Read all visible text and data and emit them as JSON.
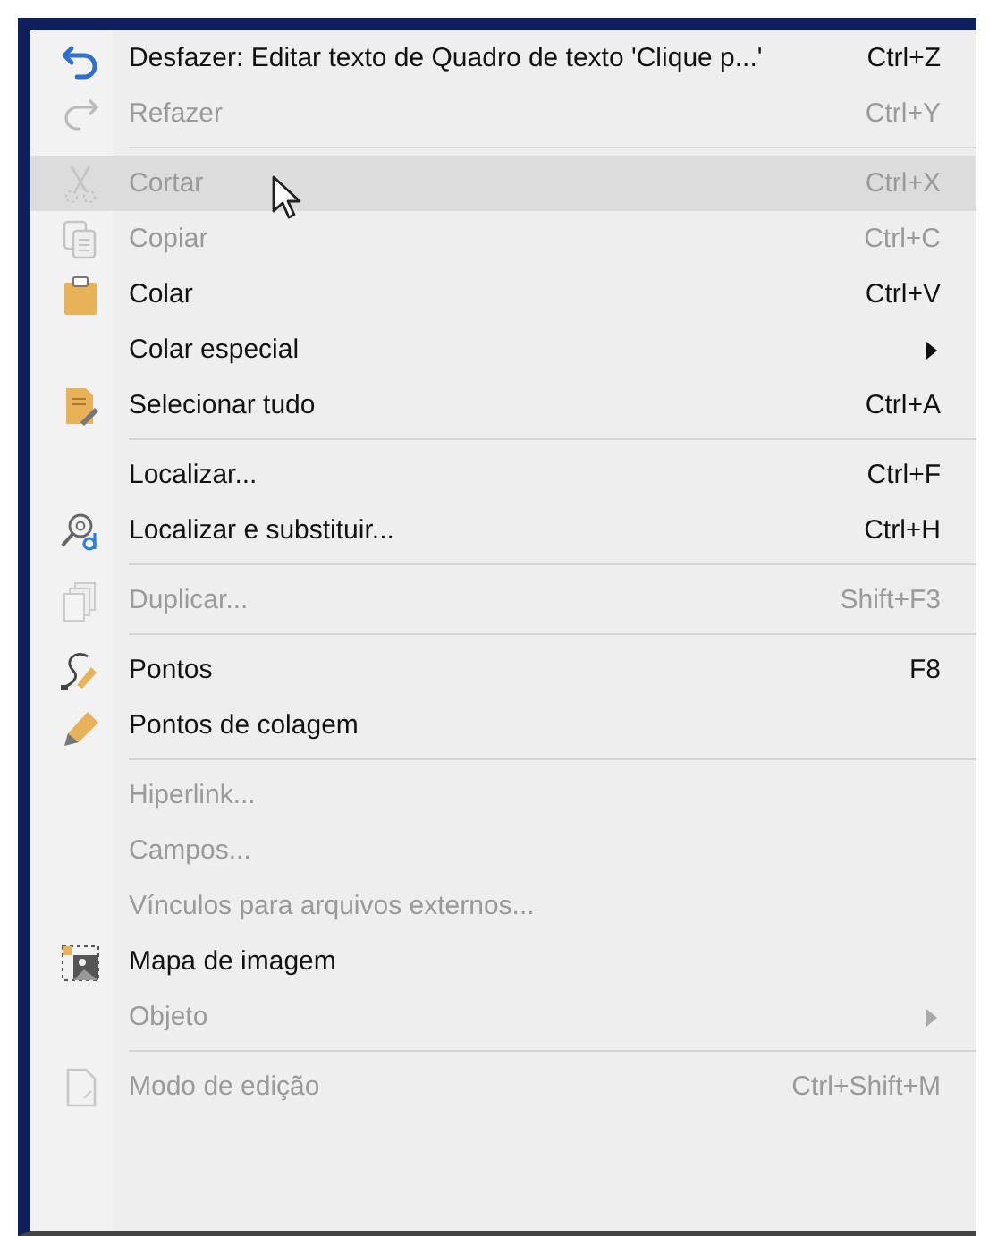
{
  "menu": {
    "items": [
      {
        "kind": "item",
        "label": "Desfazer: Editar texto de Quadro de texto 'Clique p...'",
        "shortcut": "Ctrl+Z",
        "disabled": false,
        "highlighted": false
      },
      {
        "kind": "item",
        "label": "Refazer",
        "shortcut": "Ctrl+Y",
        "disabled": true,
        "highlighted": false
      },
      {
        "kind": "separator"
      },
      {
        "kind": "item",
        "label": "Cortar",
        "shortcut": "Ctrl+X",
        "disabled": true,
        "highlighted": true
      },
      {
        "kind": "item",
        "label": "Copiar",
        "shortcut": "Ctrl+C",
        "disabled": true,
        "highlighted": false
      },
      {
        "kind": "item",
        "label": "Colar",
        "shortcut": "Ctrl+V",
        "disabled": false,
        "highlighted": false
      },
      {
        "kind": "submenu",
        "label": "Colar especial",
        "disabled": false,
        "highlighted": false
      },
      {
        "kind": "item",
        "label": "Selecionar tudo",
        "shortcut": "Ctrl+A",
        "disabled": false,
        "highlighted": false
      },
      {
        "kind": "separator"
      },
      {
        "kind": "item",
        "label": "Localizar...",
        "shortcut": "Ctrl+F",
        "disabled": false,
        "highlighted": false
      },
      {
        "kind": "item",
        "label": "Localizar e substituir...",
        "shortcut": "Ctrl+H",
        "disabled": false,
        "highlighted": false
      },
      {
        "kind": "separator"
      },
      {
        "kind": "item",
        "label": "Duplicar...",
        "shortcut": "Shift+F3",
        "disabled": true,
        "highlighted": false
      },
      {
        "kind": "separator"
      },
      {
        "kind": "item",
        "label": "Pontos",
        "shortcut": "F8",
        "disabled": false,
        "highlighted": false
      },
      {
        "kind": "item",
        "label": "Pontos de colagem",
        "disabled": false,
        "highlighted": false
      },
      {
        "kind": "separator"
      },
      {
        "kind": "item",
        "label": "Hiperlink...",
        "disabled": true,
        "highlighted": false
      },
      {
        "kind": "item",
        "label": "Campos...",
        "disabled": true,
        "highlighted": false
      },
      {
        "kind": "item",
        "label": "Vínculos para arquivos externos...",
        "disabled": true,
        "highlighted": false
      },
      {
        "kind": "item",
        "label": "Mapa de imagem",
        "disabled": false,
        "highlighted": false
      },
      {
        "kind": "submenu",
        "label": "Objeto",
        "disabled": true,
        "highlighted": false
      },
      {
        "kind": "separator"
      },
      {
        "kind": "item",
        "label": "Modo de edição",
        "shortcut": "Ctrl+Shift+M",
        "disabled": true,
        "highlighted": false
      }
    ]
  }
}
